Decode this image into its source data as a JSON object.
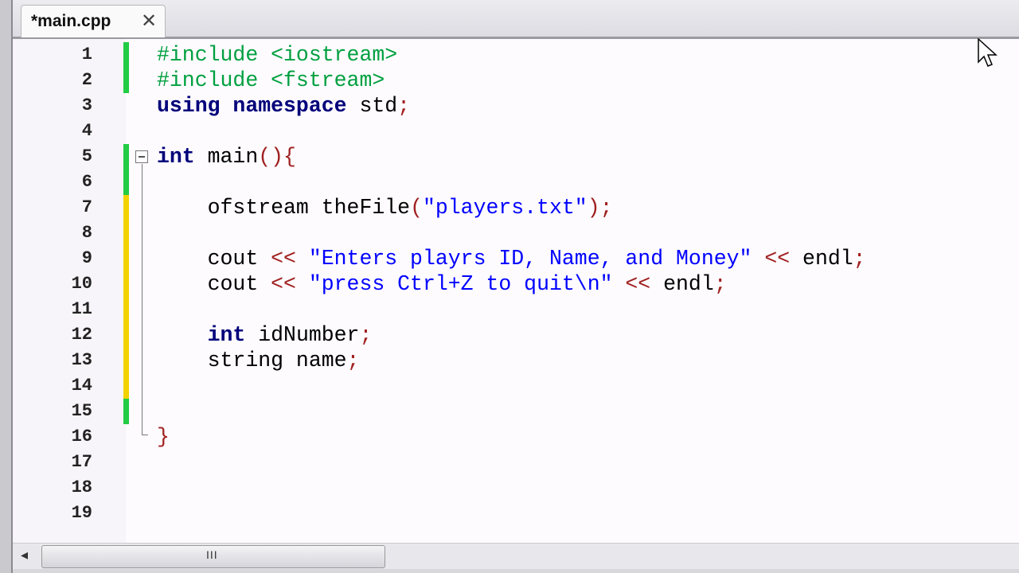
{
  "tab": {
    "label": "*main.cpp",
    "close": "✕"
  },
  "scroll": {
    "left_arrow": "◂",
    "grip": "III"
  },
  "lines": [
    {
      "n": "1",
      "mark": "green",
      "tokens": [
        {
          "t": "#include <iostream>",
          "c": "pp"
        }
      ]
    },
    {
      "n": "2",
      "mark": "green",
      "tokens": [
        {
          "t": "#include <fstream>",
          "c": "pp"
        }
      ]
    },
    {
      "n": "3",
      "mark": "",
      "tokens": [
        {
          "t": "using namespace",
          "c": "kw"
        },
        {
          "t": " std",
          "c": "id"
        },
        {
          "t": ";",
          "c": "pun"
        }
      ]
    },
    {
      "n": "4",
      "mark": "",
      "tokens": []
    },
    {
      "n": "5",
      "mark": "green",
      "tokens": [
        {
          "t": "int",
          "c": "kw"
        },
        {
          "t": " main",
          "c": "id"
        },
        {
          "t": "(){",
          "c": "pun"
        }
      ]
    },
    {
      "n": "6",
      "mark": "green",
      "tokens": []
    },
    {
      "n": "7",
      "mark": "yellow",
      "tokens": [
        {
          "t": "    ofstream theFile",
          "c": "id"
        },
        {
          "t": "(",
          "c": "pun"
        },
        {
          "t": "\"players.txt\"",
          "c": "str"
        },
        {
          "t": ");",
          "c": "pun"
        }
      ]
    },
    {
      "n": "8",
      "mark": "yellow",
      "tokens": []
    },
    {
      "n": "9",
      "mark": "yellow",
      "tokens": [
        {
          "t": "    cout ",
          "c": "id"
        },
        {
          "t": "<<",
          "c": "pun"
        },
        {
          "t": " \"Enters playrs ID, Name, and Money\" ",
          "c": "str"
        },
        {
          "t": "<<",
          "c": "pun"
        },
        {
          "t": " endl",
          "c": "id"
        },
        {
          "t": ";",
          "c": "pun"
        }
      ]
    },
    {
      "n": "10",
      "mark": "yellow",
      "tokens": [
        {
          "t": "    cout ",
          "c": "id"
        },
        {
          "t": "<<",
          "c": "pun"
        },
        {
          "t": " \"press Ctrl+Z to quit\\n\" ",
          "c": "str"
        },
        {
          "t": "<<",
          "c": "pun"
        },
        {
          "t": " endl",
          "c": "id"
        },
        {
          "t": ";",
          "c": "pun"
        }
      ]
    },
    {
      "n": "11",
      "mark": "yellow",
      "tokens": []
    },
    {
      "n": "12",
      "mark": "yellow",
      "tokens": [
        {
          "t": "    int",
          "c": "kw"
        },
        {
          "t": " idNumber",
          "c": "id"
        },
        {
          "t": ";",
          "c": "pun"
        }
      ]
    },
    {
      "n": "13",
      "mark": "yellow",
      "tokens": [
        {
          "t": "    string name",
          "c": "id"
        },
        {
          "t": ";",
          "c": "pun"
        }
      ]
    },
    {
      "n": "14",
      "mark": "yellow",
      "tokens": []
    },
    {
      "n": "15",
      "mark": "green",
      "tokens": []
    },
    {
      "n": "16",
      "mark": "",
      "tokens": [
        {
          "t": "}",
          "c": "pun"
        }
      ]
    },
    {
      "n": "17",
      "mark": "",
      "tokens": []
    },
    {
      "n": "18",
      "mark": "",
      "tokens": []
    },
    {
      "n": "19",
      "mark": "",
      "tokens": []
    }
  ],
  "colors": {
    "green": "#22cc44",
    "yellow": "#f2d200"
  }
}
